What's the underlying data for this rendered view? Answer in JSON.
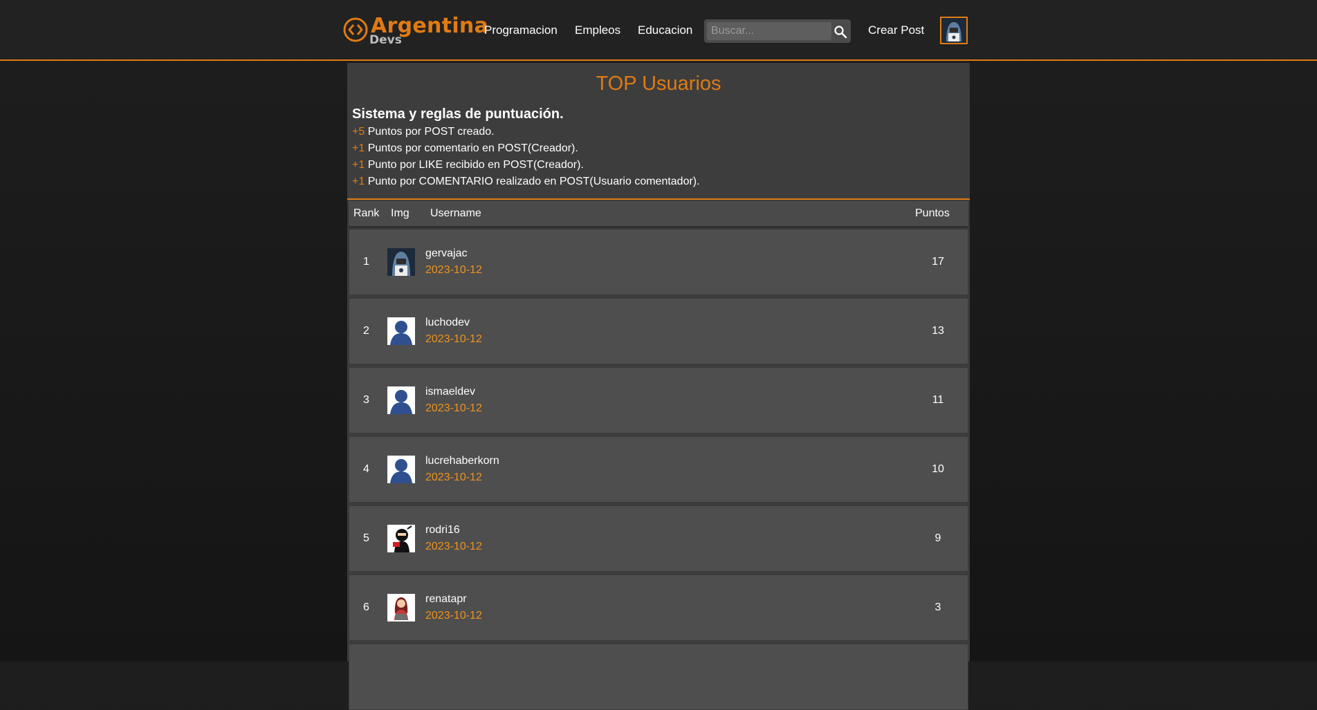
{
  "header": {
    "logo_main": "Argentina",
    "logo_sub": "Devs",
    "nav": [
      "Programacion",
      "Empleos",
      "Educacion"
    ],
    "search_placeholder": "Buscar...",
    "create_post": "Crear Post"
  },
  "page": {
    "title": "TOP Usuarios",
    "rules_title": "Sistema y reglas de puntuación.",
    "rules": [
      {
        "points": "+5",
        "text": " Puntos por POST creado."
      },
      {
        "points": "+1",
        "text": " Puntos por comentario en POST(Creador)."
      },
      {
        "points": "+1",
        "text": " Punto por LIKE recibido en POST(Creador)."
      },
      {
        "points": "+1",
        "text": " Punto por COMENTARIO realizado en POST(Usuario comentador)."
      }
    ]
  },
  "table": {
    "headers": {
      "rank": "Rank",
      "img": "Img",
      "username": "Username",
      "points": "Puntos"
    },
    "rows": [
      {
        "rank": "1",
        "username": "gervajac",
        "date": "2023-10-12",
        "points": "17",
        "avatar": "hooded-hacker-avatar"
      },
      {
        "rank": "2",
        "username": "luchodev",
        "date": "2023-10-12",
        "points": "13",
        "avatar": "default-user-avatar"
      },
      {
        "rank": "3",
        "username": "ismaeldev",
        "date": "2023-10-12",
        "points": "11",
        "avatar": "default-user-avatar"
      },
      {
        "rank": "4",
        "username": "lucrehaberkorn",
        "date": "2023-10-12",
        "points": "10",
        "avatar": "default-user-avatar"
      },
      {
        "rank": "5",
        "username": "rodri16",
        "date": "2023-10-12",
        "points": "9",
        "avatar": "ninja-avatar"
      },
      {
        "rank": "6",
        "username": "renatapr",
        "date": "2023-10-12",
        "points": "3",
        "avatar": "woman-laptop-avatar"
      }
    ]
  },
  "colors": {
    "accent": "#e07b14",
    "date": "#f0931c",
    "panel": "#3d3d3d",
    "row": "#4e4e4e"
  }
}
